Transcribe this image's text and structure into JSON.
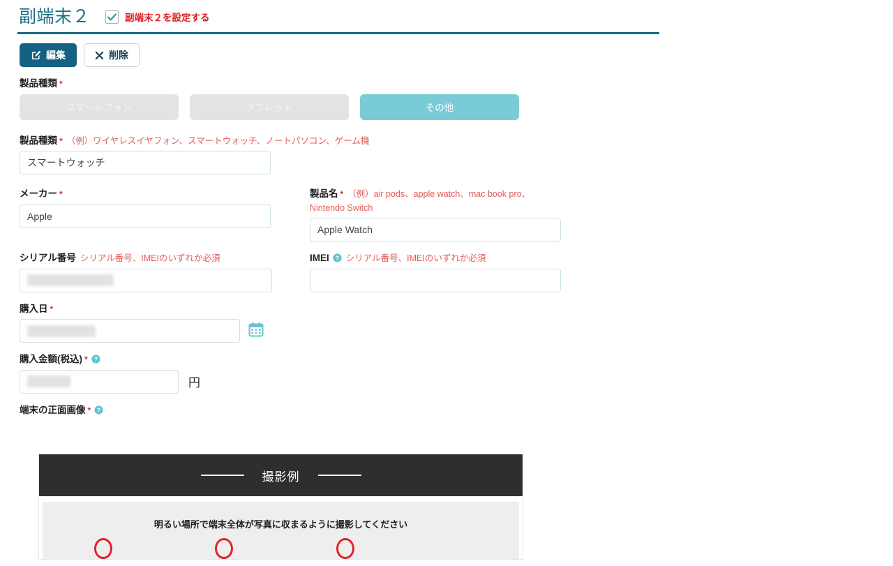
{
  "header": {
    "title": "副端末２",
    "enable_checkbox_label": "副端末２を設定する",
    "checkbox_checked": true,
    "accent_color": "#156c86",
    "alert_color": "#e02020"
  },
  "toolbar": {
    "edit_label": "編集",
    "delete_label": "削除",
    "edit_icon": "pencil-square-icon",
    "delete_icon": "close-x-icon",
    "edit_bg": "#136183"
  },
  "form": {
    "product_type": {
      "label": "製品種類",
      "required_mark": "*",
      "options": [
        {
          "label": "スマートフォン",
          "selected": false
        },
        {
          "label": "タブレット",
          "selected": false
        },
        {
          "label": "その他",
          "selected": true
        }
      ],
      "selected_color": "#79ccd7",
      "unselected_color": "#e3e3e3"
    },
    "product_type_detail": {
      "label": "製品種類",
      "required_mark": "*",
      "hint": "（例）ワイヤレスイヤフォン、スマートウォッチ、ノートパソコン、ゲーム機",
      "value": "スマートウォッチ",
      "placeholder": ""
    },
    "maker": {
      "label": "メーカー",
      "required_mark": "*",
      "value": "Apple",
      "placeholder": ""
    },
    "product_name": {
      "label": "製品名",
      "required_mark": "*",
      "hint": "（例）air pods、apple watch、mac book pro、Nintendo Switch",
      "value": "Apple Watch",
      "placeholder": ""
    },
    "serial_number": {
      "label": "シリアル番号",
      "hint": "シリアル番号、IMEIのいずれか必須",
      "value": "",
      "redacted": true
    },
    "imei": {
      "label": "IMEI",
      "help_icon": "help-circle-icon",
      "hint": "シリアル番号、IMEIのいずれか必須",
      "value": "",
      "redacted": false
    },
    "purchase_date": {
      "label": "購入日",
      "required_mark": "*",
      "value": "",
      "redacted": true,
      "calendar_icon": "calendar-icon"
    },
    "purchase_amount": {
      "label": "購入金額(税込)",
      "required_mark": "*",
      "help_icon": "help-circle-icon",
      "value": "",
      "redacted": true,
      "unit": "円"
    },
    "device_front_image": {
      "label": "端末の正面画像",
      "required_mark": "*",
      "help_icon": "help-circle-icon"
    }
  },
  "photo_example": {
    "caption": "撮影例",
    "note": "明るい場所で端末全体が写真に収まるように撮影してください",
    "header_bg": "#2e2e2e",
    "marker_color": "#e0232e",
    "marker_count": 3
  }
}
